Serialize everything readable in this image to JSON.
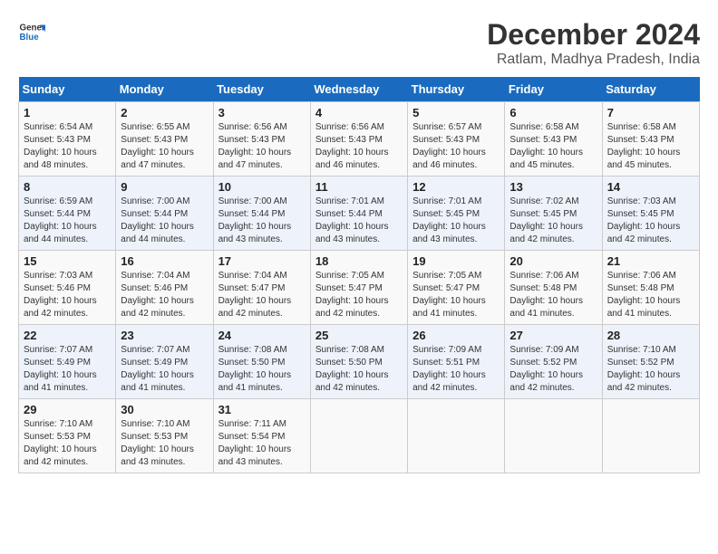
{
  "logo": {
    "name": "General",
    "name2": "Blue"
  },
  "title": "December 2024",
  "subtitle": "Ratlam, Madhya Pradesh, India",
  "days_of_week": [
    "Sunday",
    "Monday",
    "Tuesday",
    "Wednesday",
    "Thursday",
    "Friday",
    "Saturday"
  ],
  "weeks": [
    [
      {
        "num": "1",
        "info": "Sunrise: 6:54 AM\nSunset: 5:43 PM\nDaylight: 10 hours\nand 48 minutes."
      },
      {
        "num": "2",
        "info": "Sunrise: 6:55 AM\nSunset: 5:43 PM\nDaylight: 10 hours\nand 47 minutes."
      },
      {
        "num": "3",
        "info": "Sunrise: 6:56 AM\nSunset: 5:43 PM\nDaylight: 10 hours\nand 47 minutes."
      },
      {
        "num": "4",
        "info": "Sunrise: 6:56 AM\nSunset: 5:43 PM\nDaylight: 10 hours\nand 46 minutes."
      },
      {
        "num": "5",
        "info": "Sunrise: 6:57 AM\nSunset: 5:43 PM\nDaylight: 10 hours\nand 46 minutes."
      },
      {
        "num": "6",
        "info": "Sunrise: 6:58 AM\nSunset: 5:43 PM\nDaylight: 10 hours\nand 45 minutes."
      },
      {
        "num": "7",
        "info": "Sunrise: 6:58 AM\nSunset: 5:43 PM\nDaylight: 10 hours\nand 45 minutes."
      }
    ],
    [
      {
        "num": "8",
        "info": "Sunrise: 6:59 AM\nSunset: 5:44 PM\nDaylight: 10 hours\nand 44 minutes."
      },
      {
        "num": "9",
        "info": "Sunrise: 7:00 AM\nSunset: 5:44 PM\nDaylight: 10 hours\nand 44 minutes."
      },
      {
        "num": "10",
        "info": "Sunrise: 7:00 AM\nSunset: 5:44 PM\nDaylight: 10 hours\nand 43 minutes."
      },
      {
        "num": "11",
        "info": "Sunrise: 7:01 AM\nSunset: 5:44 PM\nDaylight: 10 hours\nand 43 minutes."
      },
      {
        "num": "12",
        "info": "Sunrise: 7:01 AM\nSunset: 5:45 PM\nDaylight: 10 hours\nand 43 minutes."
      },
      {
        "num": "13",
        "info": "Sunrise: 7:02 AM\nSunset: 5:45 PM\nDaylight: 10 hours\nand 42 minutes."
      },
      {
        "num": "14",
        "info": "Sunrise: 7:03 AM\nSunset: 5:45 PM\nDaylight: 10 hours\nand 42 minutes."
      }
    ],
    [
      {
        "num": "15",
        "info": "Sunrise: 7:03 AM\nSunset: 5:46 PM\nDaylight: 10 hours\nand 42 minutes."
      },
      {
        "num": "16",
        "info": "Sunrise: 7:04 AM\nSunset: 5:46 PM\nDaylight: 10 hours\nand 42 minutes."
      },
      {
        "num": "17",
        "info": "Sunrise: 7:04 AM\nSunset: 5:47 PM\nDaylight: 10 hours\nand 42 minutes."
      },
      {
        "num": "18",
        "info": "Sunrise: 7:05 AM\nSunset: 5:47 PM\nDaylight: 10 hours\nand 42 minutes."
      },
      {
        "num": "19",
        "info": "Sunrise: 7:05 AM\nSunset: 5:47 PM\nDaylight: 10 hours\nand 41 minutes."
      },
      {
        "num": "20",
        "info": "Sunrise: 7:06 AM\nSunset: 5:48 PM\nDaylight: 10 hours\nand 41 minutes."
      },
      {
        "num": "21",
        "info": "Sunrise: 7:06 AM\nSunset: 5:48 PM\nDaylight: 10 hours\nand 41 minutes."
      }
    ],
    [
      {
        "num": "22",
        "info": "Sunrise: 7:07 AM\nSunset: 5:49 PM\nDaylight: 10 hours\nand 41 minutes."
      },
      {
        "num": "23",
        "info": "Sunrise: 7:07 AM\nSunset: 5:49 PM\nDaylight: 10 hours\nand 41 minutes."
      },
      {
        "num": "24",
        "info": "Sunrise: 7:08 AM\nSunset: 5:50 PM\nDaylight: 10 hours\nand 41 minutes."
      },
      {
        "num": "25",
        "info": "Sunrise: 7:08 AM\nSunset: 5:50 PM\nDaylight: 10 hours\nand 42 minutes."
      },
      {
        "num": "26",
        "info": "Sunrise: 7:09 AM\nSunset: 5:51 PM\nDaylight: 10 hours\nand 42 minutes."
      },
      {
        "num": "27",
        "info": "Sunrise: 7:09 AM\nSunset: 5:52 PM\nDaylight: 10 hours\nand 42 minutes."
      },
      {
        "num": "28",
        "info": "Sunrise: 7:10 AM\nSunset: 5:52 PM\nDaylight: 10 hours\nand 42 minutes."
      }
    ],
    [
      {
        "num": "29",
        "info": "Sunrise: 7:10 AM\nSunset: 5:53 PM\nDaylight: 10 hours\nand 42 minutes."
      },
      {
        "num": "30",
        "info": "Sunrise: 7:10 AM\nSunset: 5:53 PM\nDaylight: 10 hours\nand 43 minutes."
      },
      {
        "num": "31",
        "info": "Sunrise: 7:11 AM\nSunset: 5:54 PM\nDaylight: 10 hours\nand 43 minutes."
      },
      {
        "num": "",
        "info": ""
      },
      {
        "num": "",
        "info": ""
      },
      {
        "num": "",
        "info": ""
      },
      {
        "num": "",
        "info": ""
      }
    ]
  ]
}
